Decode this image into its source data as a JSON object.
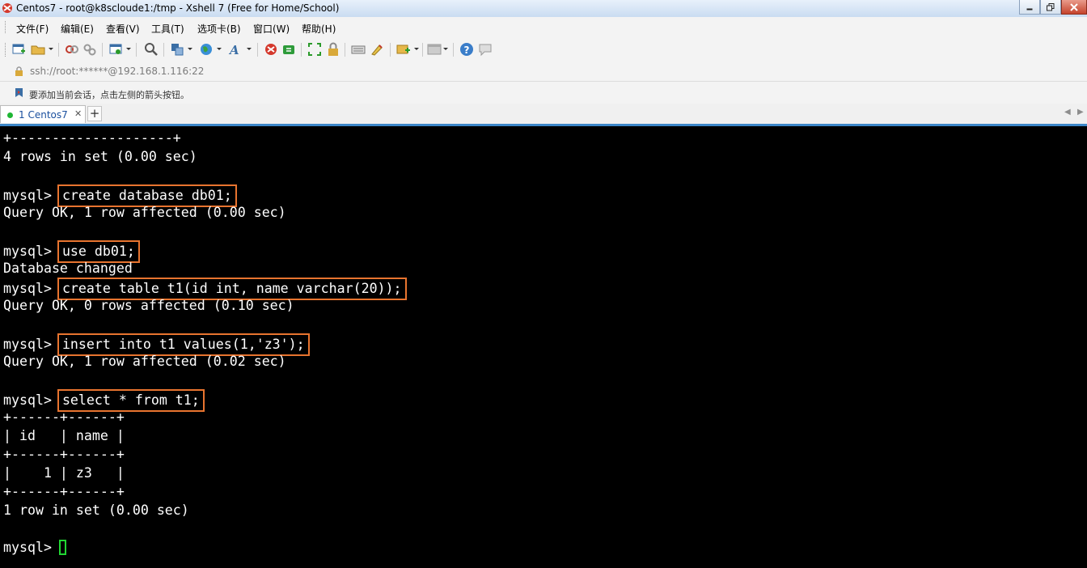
{
  "window": {
    "title": "Centos7 - root@k8scloude1:/tmp - Xshell 7 (Free for Home/School)",
    "controls": [
      "minimize",
      "maximize",
      "close"
    ]
  },
  "menu": {
    "items": [
      "文件(F)",
      "编辑(E)",
      "查看(V)",
      "工具(T)",
      "选项卡(B)",
      "窗口(W)",
      "帮助(H)"
    ]
  },
  "toolbar": {
    "icons": [
      "new-session-icon",
      "open-folder-icon",
      "connect-icon",
      "disconnect-icon",
      "properties-icon",
      "find-icon",
      "transfer-icon",
      "globe-icon",
      "font-icon",
      "xshell-icon",
      "xftp-icon",
      "fullscreen-icon",
      "lock-icon",
      "keyboard-icon",
      "highlight-icon",
      "new-tab-icon",
      "layout-icon",
      "help-icon",
      "chat-icon"
    ]
  },
  "address": {
    "value": "ssh://root:******@192.168.1.116:22"
  },
  "hint": {
    "text": "要添加当前会话，点击左侧的箭头按钮。"
  },
  "tabs": [
    {
      "label": "1 Centos7",
      "active": true,
      "status_color": "#1fb634"
    }
  ],
  "terminal": {
    "lines": [
      {
        "text": "+--------------------+"
      },
      {
        "text": "4 rows in set (0.00 sec)"
      },
      {
        "text": ""
      },
      {
        "prompt": "mysql> ",
        "command": "create database db01;",
        "highlighted": true
      },
      {
        "text": "Query OK, 1 row affected (0.00 sec)"
      },
      {
        "text": ""
      },
      {
        "prompt": "mysql> ",
        "command": "use db01;",
        "highlighted": true
      },
      {
        "text": "Database changed"
      },
      {
        "prompt": "mysql> ",
        "command": "create table t1(id int, name varchar(20));",
        "highlighted": true
      },
      {
        "text": "Query OK, 0 rows affected (0.10 sec)"
      },
      {
        "text": ""
      },
      {
        "prompt": "mysql> ",
        "command": "insert into t1 values(1,'z3');",
        "highlighted": true
      },
      {
        "text": "Query OK, 1 row affected (0.02 sec)"
      },
      {
        "text": ""
      },
      {
        "prompt": "mysql> ",
        "command": "select * from t1;",
        "highlighted": true
      },
      {
        "text": "+------+------+"
      },
      {
        "text": "| id   | name |"
      },
      {
        "text": "+------+------+"
      },
      {
        "text": "|    1 | z3   |"
      },
      {
        "text": "+------+------+"
      },
      {
        "text": "1 row in set (0.00 sec)"
      },
      {
        "text": ""
      },
      {
        "prompt": "mysql> ",
        "command": "",
        "highlighted": false
      }
    ],
    "highlight_color": "#e8742f",
    "cursor_color": "#21d633"
  }
}
